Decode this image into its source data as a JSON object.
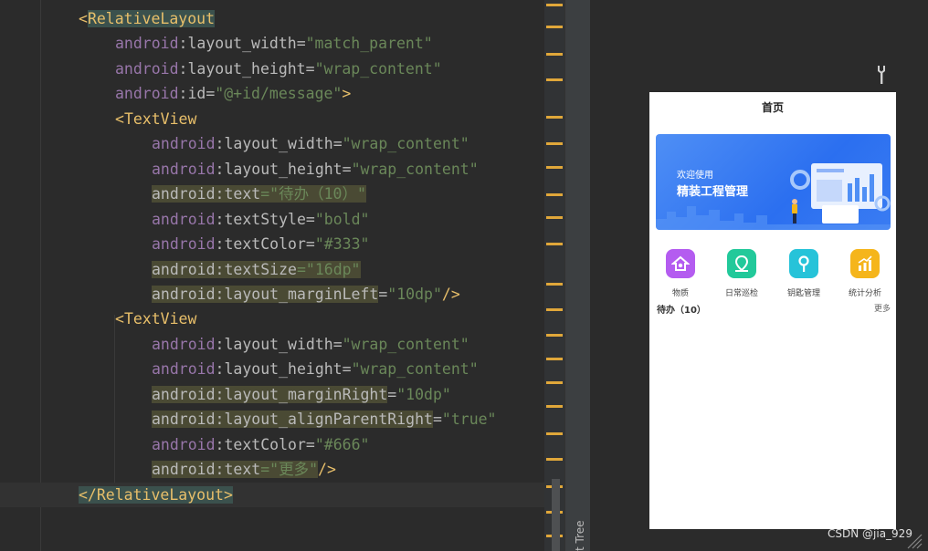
{
  "editor": {
    "lines": [
      {
        "indent": 0,
        "parts": [
          {
            "t": "<",
            "c": "tag"
          },
          {
            "t": "RelativeLayout",
            "c": "tagname",
            "hl": "tag"
          }
        ]
      },
      {
        "indent": 1,
        "parts": [
          {
            "t": "android",
            "c": "ns"
          },
          {
            "t": ":layout_width",
            "c": "attr"
          },
          {
            "t": "=",
            "c": "attr"
          },
          {
            "t": "\"match_parent\"",
            "c": "val"
          }
        ]
      },
      {
        "indent": 1,
        "parts": [
          {
            "t": "android",
            "c": "ns"
          },
          {
            "t": ":layout_height",
            "c": "attr"
          },
          {
            "t": "=",
            "c": "attr"
          },
          {
            "t": "\"wrap_content\"",
            "c": "val"
          }
        ]
      },
      {
        "indent": 1,
        "parts": [
          {
            "t": "android",
            "c": "ns"
          },
          {
            "t": ":id",
            "c": "attr"
          },
          {
            "t": "=",
            "c": "attr"
          },
          {
            "t": "\"@+id/message\"",
            "c": "val"
          },
          {
            "t": ">",
            "c": "tag"
          }
        ]
      },
      {
        "indent": 1,
        "parts": [
          {
            "t": "<",
            "c": "tag"
          },
          {
            "t": "TextView",
            "c": "tagname"
          }
        ]
      },
      {
        "indent": 2,
        "parts": [
          {
            "t": "android",
            "c": "ns"
          },
          {
            "t": ":layout_width",
            "c": "attr"
          },
          {
            "t": "=",
            "c": "attr"
          },
          {
            "t": "\"wrap_content\"",
            "c": "val"
          }
        ]
      },
      {
        "indent": 2,
        "parts": [
          {
            "t": "android",
            "c": "ns"
          },
          {
            "t": ":layout_height",
            "c": "attr"
          },
          {
            "t": "=",
            "c": "attr"
          },
          {
            "t": "\"wrap_content\"",
            "c": "val"
          }
        ]
      },
      {
        "indent": 2,
        "parts": [
          {
            "t": "android:text",
            "c": "attr",
            "hl": "attr"
          },
          {
            "t": "=\"待办（10）\"",
            "c": "val",
            "hl": "attr"
          }
        ]
      },
      {
        "indent": 2,
        "parts": [
          {
            "t": "android",
            "c": "ns"
          },
          {
            "t": ":textStyle",
            "c": "attr"
          },
          {
            "t": "=",
            "c": "attr"
          },
          {
            "t": "\"bold\"",
            "c": "val"
          }
        ]
      },
      {
        "indent": 2,
        "parts": [
          {
            "t": "android",
            "c": "ns"
          },
          {
            "t": ":textColor",
            "c": "attr"
          },
          {
            "t": "=",
            "c": "attr"
          },
          {
            "t": "\"#333\"",
            "c": "val"
          }
        ]
      },
      {
        "indent": 2,
        "parts": [
          {
            "t": "android:textSize",
            "c": "attr",
            "hl": "attr"
          },
          {
            "t": "=\"16dp\"",
            "c": "val",
            "hl": "attr"
          }
        ]
      },
      {
        "indent": 2,
        "parts": [
          {
            "t": "android:layout_marginLeft",
            "c": "attr",
            "hl": "attr"
          },
          {
            "t": "=",
            "c": "attr"
          },
          {
            "t": "\"10dp\"",
            "c": "val"
          },
          {
            "t": "/>",
            "c": "tag"
          }
        ]
      },
      {
        "indent": 1,
        "parts": [
          {
            "t": "<",
            "c": "tag"
          },
          {
            "t": "TextView",
            "c": "tagname"
          }
        ]
      },
      {
        "indent": 2,
        "parts": [
          {
            "t": "android",
            "c": "ns"
          },
          {
            "t": ":layout_width",
            "c": "attr"
          },
          {
            "t": "=",
            "c": "attr"
          },
          {
            "t": "\"wrap_content\"",
            "c": "val"
          }
        ]
      },
      {
        "indent": 2,
        "parts": [
          {
            "t": "android",
            "c": "ns"
          },
          {
            "t": ":layout_height",
            "c": "attr"
          },
          {
            "t": "=",
            "c": "attr"
          },
          {
            "t": "\"wrap_content\"",
            "c": "val"
          }
        ]
      },
      {
        "indent": 2,
        "parts": [
          {
            "t": "android:layout_marginRight",
            "c": "attr",
            "hl": "attr"
          },
          {
            "t": "=",
            "c": "attr"
          },
          {
            "t": "\"10dp\"",
            "c": "val"
          }
        ]
      },
      {
        "indent": 2,
        "parts": [
          {
            "t": "android:layout_alignParentRight",
            "c": "attr",
            "hl": "attr"
          },
          {
            "t": "=",
            "c": "attr"
          },
          {
            "t": "\"true\"",
            "c": "val"
          }
        ]
      },
      {
        "indent": 2,
        "parts": [
          {
            "t": "android",
            "c": "ns"
          },
          {
            "t": ":textColor",
            "c": "attr"
          },
          {
            "t": "=",
            "c": "attr"
          },
          {
            "t": "\"#666\"",
            "c": "val"
          }
        ]
      },
      {
        "indent": 2,
        "parts": [
          {
            "t": "android:text",
            "c": "attr",
            "hl": "attr"
          },
          {
            "t": "=\"更多\"",
            "c": "val",
            "hl": "attr"
          },
          {
            "t": "/>",
            "c": "tag"
          }
        ]
      },
      {
        "indent": 0,
        "parts": [
          {
            "t": "</",
            "c": "tag",
            "hl": "tag"
          },
          {
            "t": "RelativeLayout",
            "c": "tagname",
            "hl": "tag"
          },
          {
            "t": ">",
            "c": "tag",
            "hl": "tag"
          }
        ]
      }
    ]
  },
  "component_tree_label": "t Tree",
  "phone": {
    "title": "首页",
    "banner_line1": "欢迎使用",
    "banner_line2": "精装工程管理",
    "nav": [
      {
        "label": "物质",
        "color": "#b45cf0",
        "icon": "home-icon"
      },
      {
        "label": "日常巡检",
        "color": "#22c99a",
        "icon": "map-pin-icon"
      },
      {
        "label": "钥匙管理",
        "color": "#26c3d9",
        "icon": "key-icon"
      },
      {
        "label": "统计分析",
        "color": "#f5b51b",
        "icon": "chart-icon"
      }
    ],
    "todo": "待办（10）",
    "more": "更多"
  },
  "watermark": "CSDN @jia_929",
  "colors": {
    "editor_bg": "#2b2b2b",
    "tag": "#e8bf6a",
    "namespace": "#9876aa",
    "value": "#6a8759",
    "marker": "#e0a73a"
  }
}
